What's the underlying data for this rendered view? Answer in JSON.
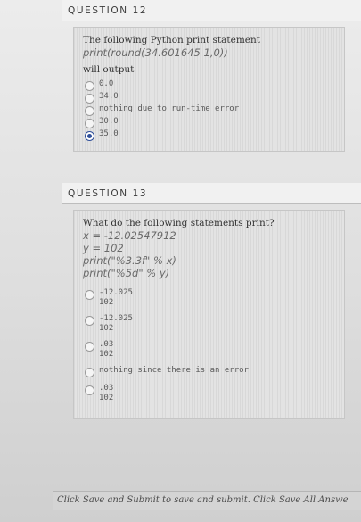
{
  "question12": {
    "header": "QUESTION 12",
    "prompt": "The following Python print statement",
    "code": "print(round(34.601645 1,0))",
    "after": "will output",
    "options": [
      {
        "label": "0.0",
        "selected": false
      },
      {
        "label": "34.0",
        "selected": false
      },
      {
        "label": "nothing due to run-time error",
        "selected": false
      },
      {
        "label": "30.0",
        "selected": false
      },
      {
        "label": "35.0",
        "selected": true
      }
    ]
  },
  "question13": {
    "header": "QUESTION 13",
    "prompt": "What do the following statements print?",
    "code_lines": [
      "x = -12.02547912",
      "y = 102",
      "print(\"%3.3f\" % x)",
      "print(\"%5d\" % y)"
    ],
    "options": [
      {
        "line1": "-12.025",
        "line2": "102",
        "selected": false
      },
      {
        "line1": "-12.025",
        "line2": "102",
        "selected": false
      },
      {
        "line1": ".03",
        "line2": "102",
        "selected": false
      },
      {
        "line1": "nothing since there is an error",
        "line2": "",
        "selected": false
      },
      {
        "line1": ".03",
        "line2": "102",
        "selected": false
      }
    ]
  },
  "footer": {
    "text": "Click Save and Submit to save and submit. Click Save All Answe"
  },
  "colors": {
    "selected_radio": "#2f4f9a"
  }
}
